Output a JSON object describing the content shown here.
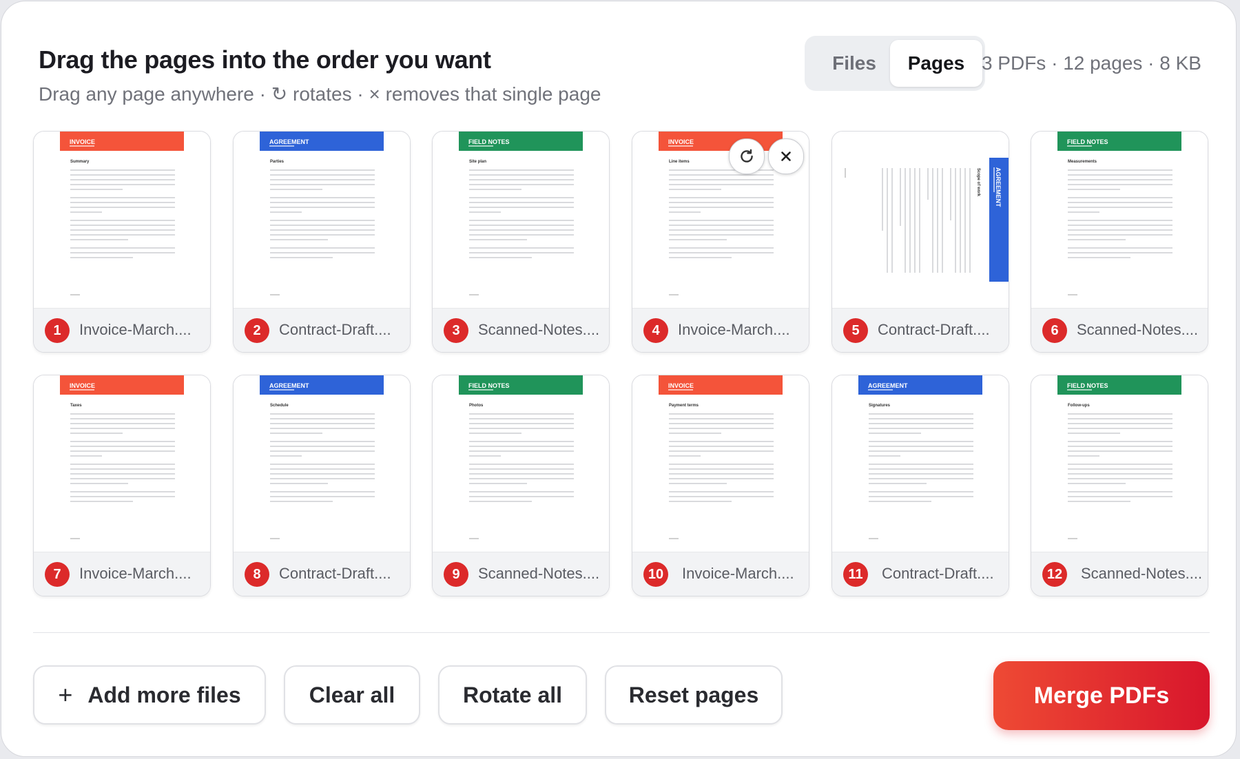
{
  "header": {
    "title": "Drag the pages into the order you want",
    "subtitle": "Drag any page anywhere · ↻ rotates · × removes that single page"
  },
  "view_toggle": {
    "files_label": "Files",
    "pages_label": "Pages",
    "active": "Pages"
  },
  "summary": "3 PDFs · 12 pages · 8 KB",
  "pages": [
    {
      "num": "1",
      "file": "Invoice-March....",
      "doc": "INVOICE",
      "section": "Summary",
      "color": "#f4543a",
      "rotated": false
    },
    {
      "num": "2",
      "file": "Contract-Draft....",
      "doc": "AGREEMENT",
      "section": "Parties",
      "color": "#2e63d8",
      "rotated": false
    },
    {
      "num": "3",
      "file": "Scanned-Notes....",
      "doc": "FIELD NOTES",
      "section": "Site plan",
      "color": "#20945a",
      "rotated": false
    },
    {
      "num": "4",
      "file": "Invoice-March....",
      "doc": "INVOICE",
      "section": "Line items",
      "color": "#f4543a",
      "rotated": false
    },
    {
      "num": "5",
      "file": "Contract-Draft....",
      "doc": "AGREEMENT",
      "section": "Scope of work",
      "color": "#2e63d8",
      "rotated": true
    },
    {
      "num": "6",
      "file": "Scanned-Notes....",
      "doc": "FIELD NOTES",
      "section": "Measurements",
      "color": "#20945a",
      "rotated": false
    },
    {
      "num": "7",
      "file": "Invoice-March....",
      "doc": "INVOICE",
      "section": "Taxes",
      "color": "#f4543a",
      "rotated": false
    },
    {
      "num": "8",
      "file": "Contract-Draft....",
      "doc": "AGREEMENT",
      "section": "Schedule",
      "color": "#2e63d8",
      "rotated": false
    },
    {
      "num": "9",
      "file": "Scanned-Notes....",
      "doc": "FIELD NOTES",
      "section": "Photos",
      "color": "#20945a",
      "rotated": false
    },
    {
      "num": "10",
      "file": "Invoice-March....",
      "doc": "INVOICE",
      "section": "Payment terms",
      "color": "#f4543a",
      "rotated": false
    },
    {
      "num": "11",
      "file": "Contract-Draft....",
      "doc": "AGREEMENT",
      "section": "Signatures",
      "color": "#2e63d8",
      "rotated": false
    },
    {
      "num": "12",
      "file": "Scanned-Notes....",
      "doc": "FIELD NOTES",
      "section": "Follow-ups",
      "color": "#20945a",
      "rotated": false
    }
  ],
  "hover_controls": {
    "page": "4",
    "rotate_icon": "rotate-icon",
    "remove_icon": "close-icon"
  },
  "actions": {
    "add_files": "Add more files",
    "clear_all": "Clear all",
    "rotate_all": "Rotate all",
    "reset_pages": "Reset pages",
    "merge": "Merge PDFs"
  },
  "colors": {
    "accent": "#e2252f",
    "badge": "#dc2a2a",
    "invoice": "#f4543a",
    "agreement": "#2e63d8",
    "notes": "#20945a"
  }
}
